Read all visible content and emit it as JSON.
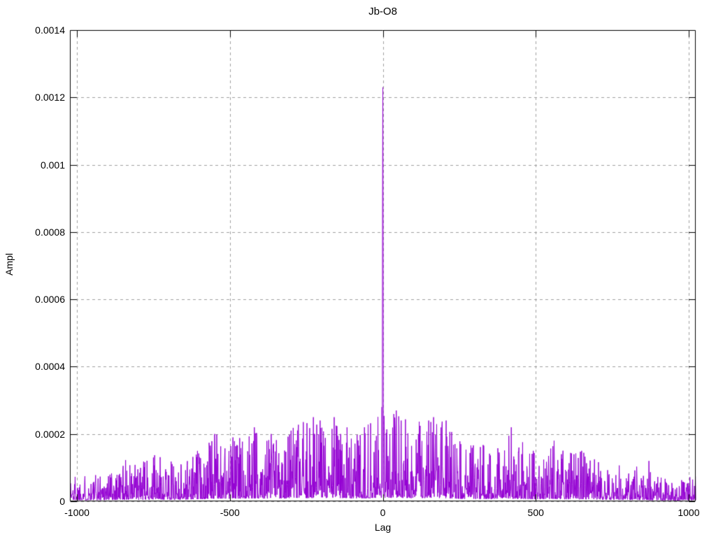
{
  "figure": {
    "background": "#ffffff",
    "frame_color": "#000000",
    "text_color": "#000000"
  },
  "chart_data": {
    "type": "line",
    "title": "Jb-O8",
    "xlabel": "Lag",
    "ylabel": "Ampl",
    "xlim": [
      -1023,
      1023
    ],
    "ylim": [
      0,
      0.0014
    ],
    "grid": true,
    "legend": "none",
    "line_color": "#9400d3",
    "grid_color": "#a0a0a0",
    "xticks": [
      {
        "value": -1000,
        "label": "-1000"
      },
      {
        "value": -500,
        "label": "-500"
      },
      {
        "value": 0,
        "label": "0"
      },
      {
        "value": 500,
        "label": "500"
      },
      {
        "value": 1000,
        "label": "1000"
      }
    ],
    "yticks": [
      {
        "value": 0,
        "label": "0"
      },
      {
        "value": 0.0002,
        "label": "0.0002"
      },
      {
        "value": 0.0004,
        "label": "0.0004"
      },
      {
        "value": 0.0006,
        "label": "0.0006"
      },
      {
        "value": 0.0008,
        "label": "0.0008"
      },
      {
        "value": 0.001,
        "label": "0.001"
      },
      {
        "value": 0.0012,
        "label": "0.0012"
      },
      {
        "value": 0.0014,
        "label": "0.0014"
      }
    ],
    "main_peak": {
      "lag": 0,
      "ampl": 0.00123
    },
    "center_peak_profile": [
      [
        -3,
        0.00028
      ],
      [
        -2,
        4e-05
      ],
      [
        -1,
        0.00087
      ],
      [
        0,
        0.00123
      ],
      [
        1,
        0.00085
      ],
      [
        2,
        5e-05
      ]
    ],
    "notable_peaks": [
      [
        -750,
        0.00013
      ],
      [
        -550,
        0.0002
      ],
      [
        -490,
        0.00019
      ],
      [
        -420,
        0.00022
      ],
      [
        -365,
        0.0002
      ],
      [
        -300,
        0.00021
      ],
      [
        -227,
        0.00025
      ],
      [
        -205,
        0.00024
      ],
      [
        -159,
        0.00025
      ],
      [
        -138,
        0.0002
      ],
      [
        -60,
        0.00022
      ],
      [
        44,
        0.00027
      ],
      [
        60,
        0.00024
      ],
      [
        150,
        0.00024
      ],
      [
        166,
        0.00025
      ],
      [
        207,
        0.00024
      ],
      [
        255,
        0.00017
      ],
      [
        420,
        0.00022
      ],
      [
        445,
        0.00016
      ],
      [
        560,
        0.00018
      ],
      [
        650,
        0.00015
      ],
      [
        870,
        0.00012
      ]
    ],
    "noise_envelope": [
      [
        -1023,
        9e-05
      ],
      [
        -950,
        8e-05
      ],
      [
        -900,
        0.0001
      ],
      [
        -850,
        0.00013
      ],
      [
        -800,
        0.00011
      ],
      [
        -750,
        0.00014
      ],
      [
        -700,
        0.00012
      ],
      [
        -650,
        0.00013
      ],
      [
        -600,
        0.00016
      ],
      [
        -550,
        0.0002
      ],
      [
        -500,
        0.00019
      ],
      [
        -450,
        0.00021
      ],
      [
        -400,
        0.00022
      ],
      [
        -350,
        0.00021
      ],
      [
        -300,
        0.00022
      ],
      [
        -250,
        0.00024
      ],
      [
        -200,
        0.00025
      ],
      [
        -150,
        0.00025
      ],
      [
        -100,
        0.00022
      ],
      [
        -50,
        0.00023
      ],
      [
        0,
        0.00027
      ],
      [
        50,
        0.00026
      ],
      [
        100,
        0.00023
      ],
      [
        150,
        0.00025
      ],
      [
        200,
        0.00024
      ],
      [
        250,
        0.00019
      ],
      [
        300,
        0.00018
      ],
      [
        350,
        0.00017
      ],
      [
        400,
        0.00022
      ],
      [
        450,
        0.00018
      ],
      [
        500,
        0.00016
      ],
      [
        550,
        0.00018
      ],
      [
        600,
        0.00015
      ],
      [
        650,
        0.00015
      ],
      [
        700,
        0.00013
      ],
      [
        750,
        0.00012
      ],
      [
        800,
        0.00011
      ],
      [
        850,
        0.0001
      ],
      [
        900,
        8e-05
      ],
      [
        950,
        7e-05
      ],
      [
        1000,
        7e-05
      ],
      [
        1023,
        9e-05
      ]
    ],
    "noise_seed": 1337
  }
}
